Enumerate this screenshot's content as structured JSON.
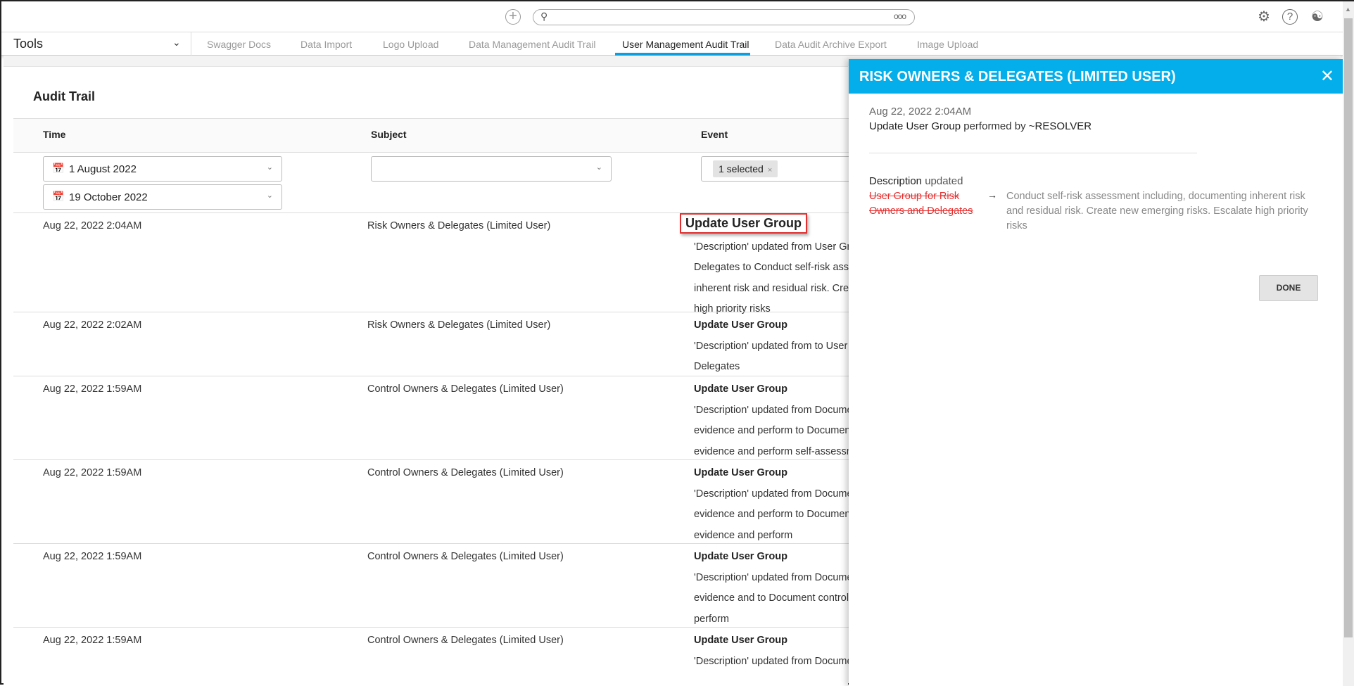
{
  "topbar": {
    "search_placeholder": "",
    "more": "ooo"
  },
  "nav": {
    "tools_label": "Tools",
    "tabs": [
      "Swagger Docs",
      "Data Import",
      "Logo Upload",
      "Data Management Audit Trail",
      "User Management Audit Trail",
      "Data Audit Archive Export",
      "Image Upload"
    ],
    "active_tab": "User Management Audit Trail"
  },
  "page": {
    "title": "Audit Trail"
  },
  "table": {
    "headers": {
      "time": "Time",
      "subject": "Subject",
      "event": "Event"
    },
    "filters": {
      "date_from": "1 August 2022",
      "date_to": "19 October 2022",
      "subject": "",
      "event_chip": "1 selected"
    },
    "rows": [
      {
        "time": "Aug 22, 2022 2:04AM",
        "subject": "Risk Owners & Delegates (Limited User)",
        "event": "Update User Group",
        "lines": [
          "'Description' updated from User Gro",
          "Delegates to Conduct self-risk asse",
          "inherent risk and residual risk. Creat",
          "high priority risks"
        ]
      },
      {
        "time": "Aug 22, 2022 2:02AM",
        "subject": "Risk Owners & Delegates (Limited User)",
        "event": "Update User Group",
        "lines": [
          "'Description' updated from to User G",
          "Delegates"
        ]
      },
      {
        "time": "Aug 22, 2022 1:59AM",
        "subject": "Control Owners & Delegates (Limited User)",
        "event": "Update User Group",
        "lines": [
          "'Description' updated from Docume",
          "evidence and perform to Document",
          "evidence and perform self-assessm"
        ]
      },
      {
        "time": "Aug 22, 2022 1:59AM",
        "subject": "Control Owners & Delegates (Limited User)",
        "event": "Update User Group",
        "lines": [
          "'Description' updated from Docume",
          "evidence and perform to Document",
          "evidence and perform"
        ]
      },
      {
        "time": "Aug 22, 2022 1:59AM",
        "subject": "Control Owners & Delegates (Limited User)",
        "event": "Update User Group",
        "lines": [
          "'Description' updated from Docume",
          "evidence and to Document control c",
          "perform"
        ]
      },
      {
        "time": "Aug 22, 2022 1:59AM",
        "subject": "Control Owners & Delegates (Limited User)",
        "event": "Update User Group",
        "lines": [
          "'Description' updated from Docume"
        ]
      }
    ]
  },
  "panel": {
    "title": "RISK OWNERS & DELEGATES (LIMITED USER)",
    "date": "Aug 22, 2022 2:04AM",
    "action": "Update User Group",
    "performed_by_text": "performed by",
    "user": "~RESOLVER",
    "field": "Description",
    "field_suffix": "updated",
    "old_value": "User Group for Risk Owners and Delegates",
    "arrow": "→",
    "new_value": "Conduct self-risk assessment including, documenting inherent risk and residual risk. Create new emerging risks. Escalate high priority risks",
    "done_label": "DONE"
  },
  "colors": {
    "accent": "#03aeea",
    "highlight": "#e03030",
    "strike": "#e53030"
  }
}
